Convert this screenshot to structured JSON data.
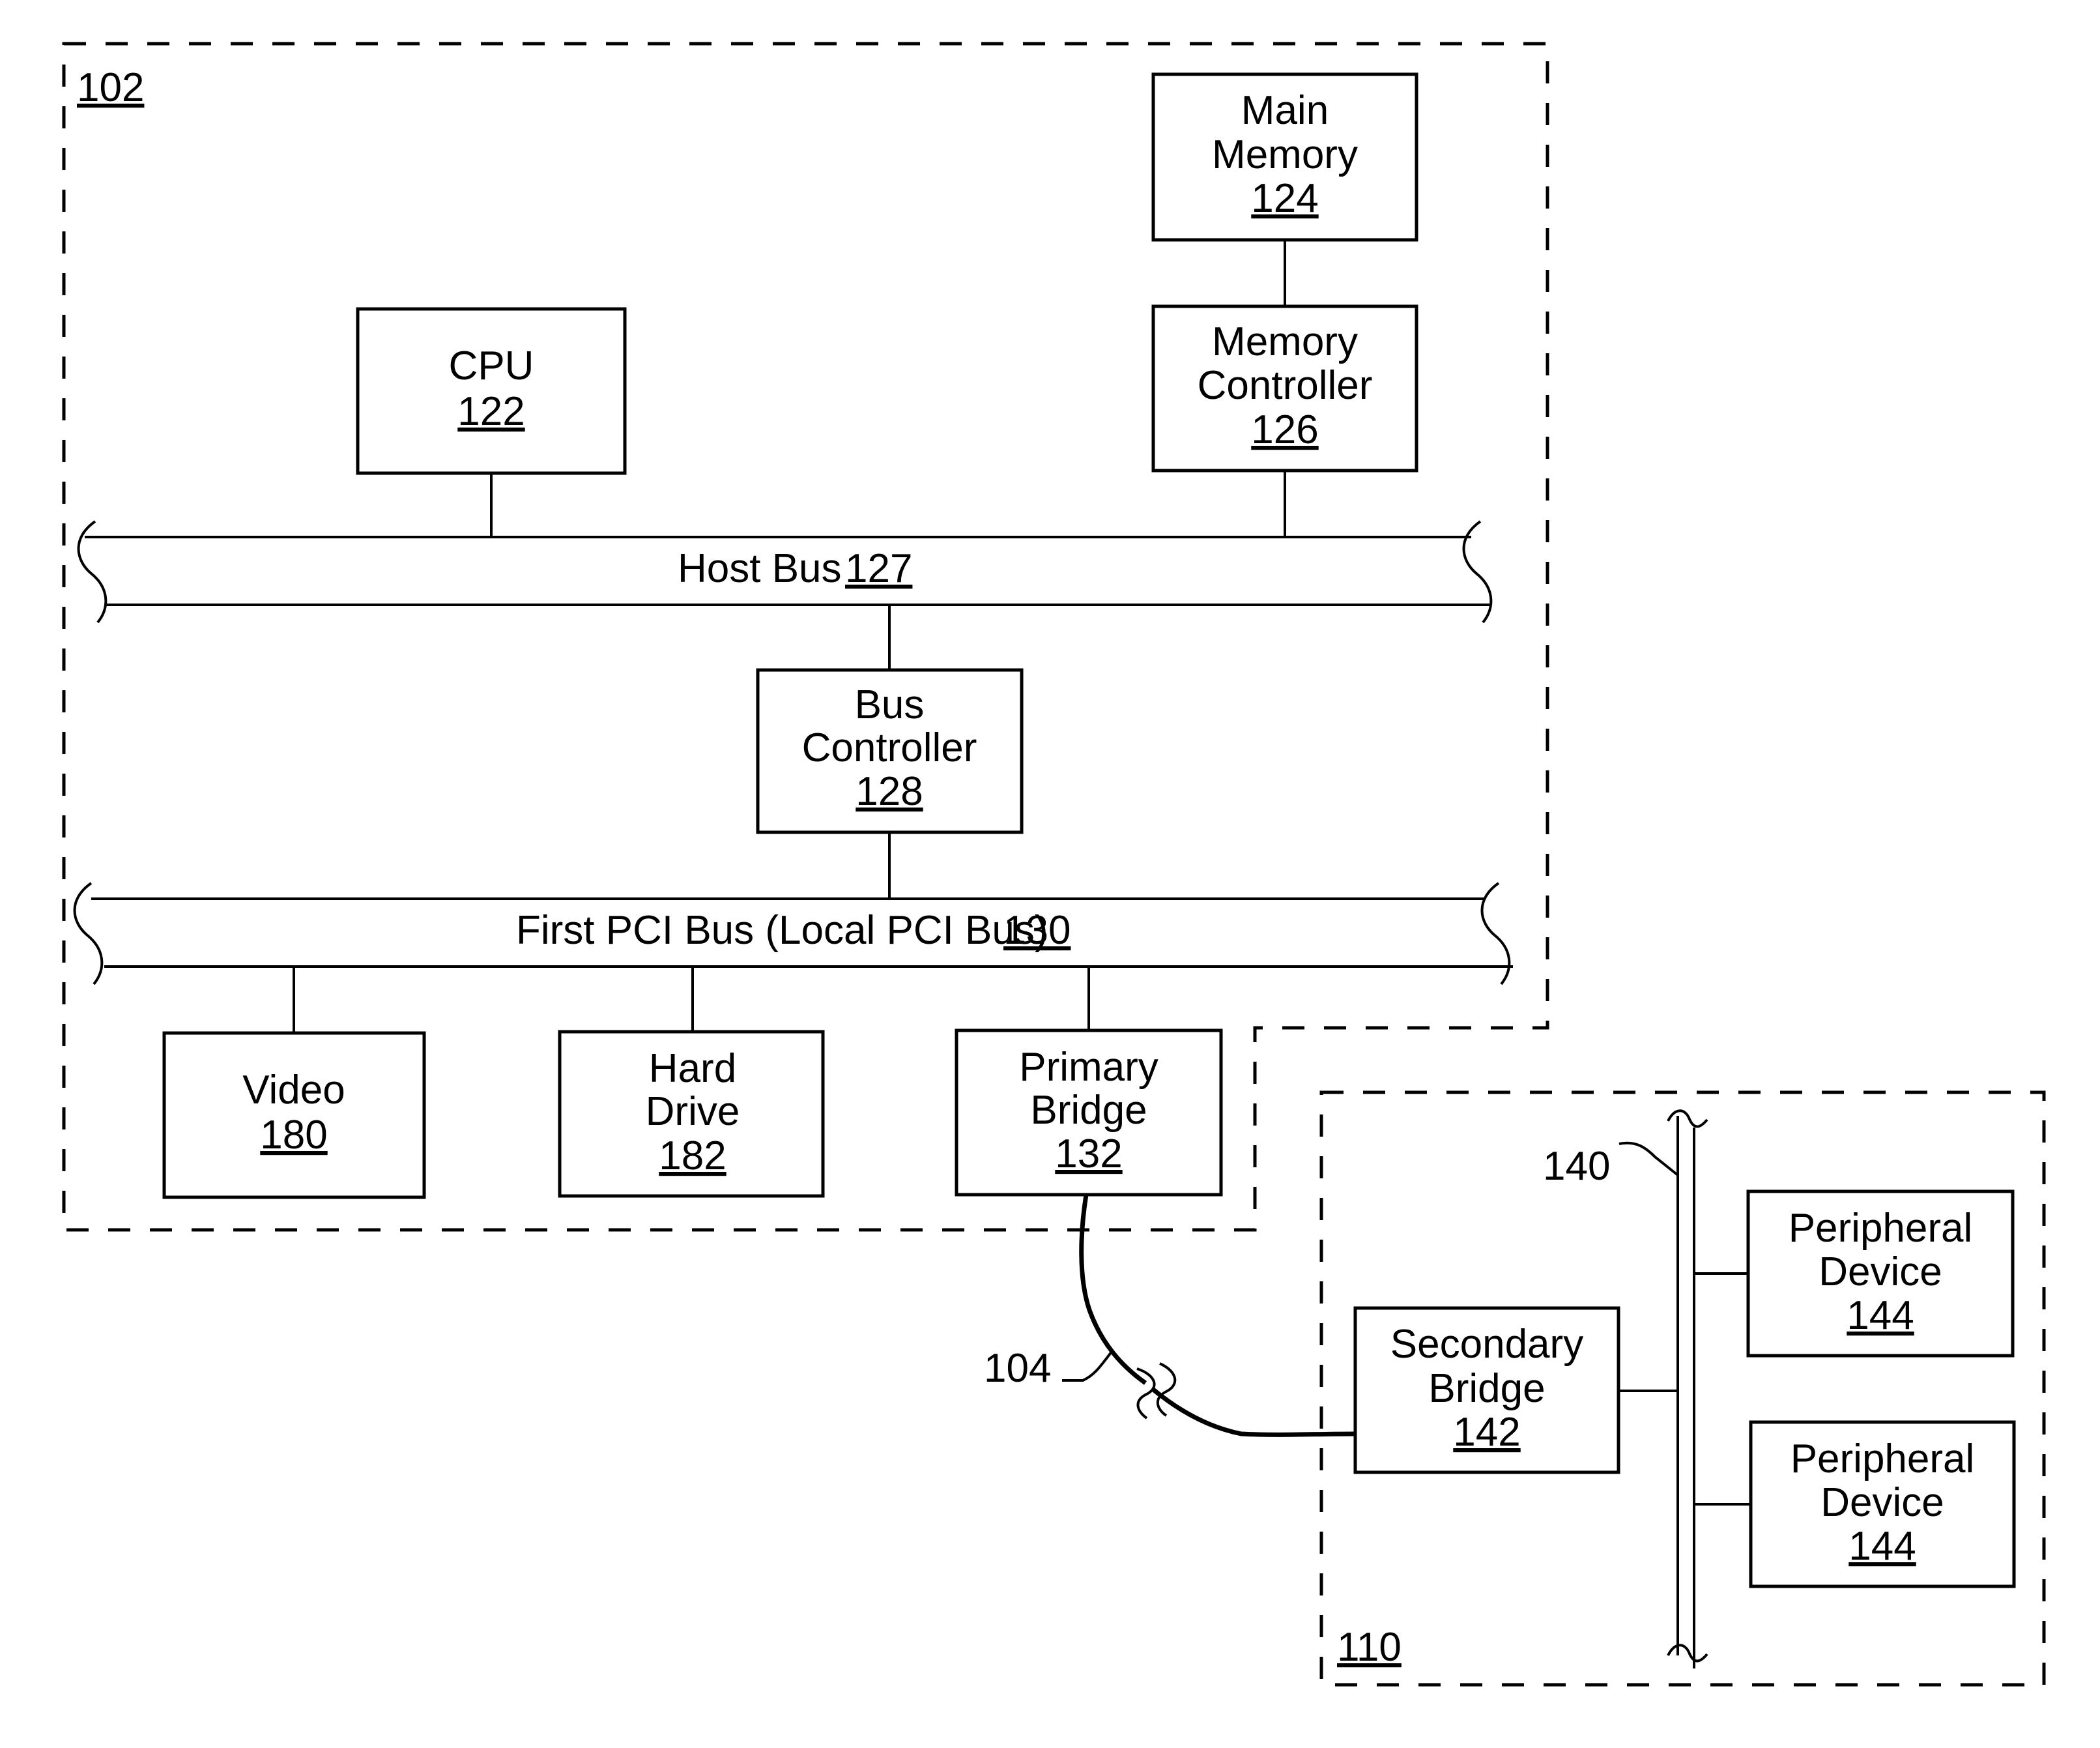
{
  "figure": {
    "system_ref": "102",
    "remote_ref": "110",
    "link_ref": "104",
    "bus140_ref": "140"
  },
  "components": {
    "main_memory": {
      "line1": "Main",
      "line2": "Memory",
      "ref": "124"
    },
    "memory_controller": {
      "line1": "Memory",
      "line2": "Controller",
      "ref": "126"
    },
    "cpu": {
      "line1": "CPU",
      "ref": "122"
    },
    "bus_controller": {
      "line1": "Bus",
      "line2": "Controller",
      "ref": "128"
    },
    "video": {
      "line1": "Video",
      "ref": "180"
    },
    "hard_drive": {
      "line1": "Hard",
      "line2": "Drive",
      "ref": "182"
    },
    "primary_bridge": {
      "line1": "Primary",
      "line2": "Bridge",
      "ref": "132"
    },
    "secondary_bridge": {
      "line1": "Secondary",
      "line2": "Bridge",
      "ref": "142"
    },
    "peripheral_1": {
      "line1": "Peripheral",
      "line2": "Device",
      "ref": "144"
    },
    "peripheral_2": {
      "line1": "Peripheral",
      "line2": "Device",
      "ref": "144"
    }
  },
  "buses": {
    "host_bus": {
      "label": "Host Bus",
      "ref": "127"
    },
    "pci_bus": {
      "label": "First PCI Bus (Local PCI Bus)",
      "ref": "130"
    }
  }
}
